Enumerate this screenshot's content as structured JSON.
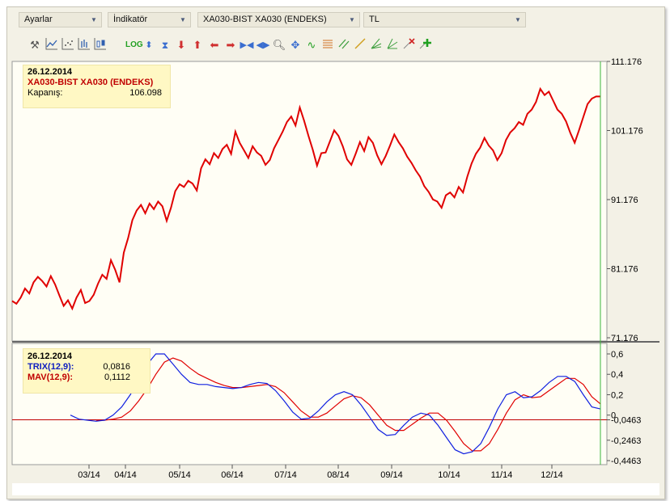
{
  "toolbar": {
    "settings_label": "Ayarlar",
    "indicator_label": "İndikatör",
    "symbol_label": "XA030-BIST XA030 (ENDEKS)",
    "currency_label": "TL",
    "log_label": "LOG"
  },
  "icons": [
    "tools-icon",
    "line-chart-icon",
    "dot-chart-icon",
    "bar-chart-icon",
    "candlestick-icon",
    "log-scale-button",
    "updown-icon",
    "hourglass-icon",
    "arrow-down-icon",
    "arrow-up-icon",
    "arrow-left-icon",
    "arrow-right-icon",
    "shrink-horizontal-icon",
    "expand-horizontal-icon",
    "zoom-icon",
    "move-icon",
    "squiggle-icon",
    "channel-icon",
    "parallel-lines-icon",
    "trendline-icon",
    "fibonacci-icon",
    "fibonacci-fan-icon",
    "delete-drawings-icon",
    "add-icon"
  ],
  "colors": {
    "price_line": "#e00000",
    "trix_line": "#1020e0",
    "mav_line": "#e00000",
    "zero_line": "#c00000",
    "cursor_line": "#3bb53b",
    "panel_bg": "#fffef5"
  },
  "price_info": {
    "date": "26.12.2014",
    "name": "XA030-BIST XA030 (ENDEKS)",
    "close_label": "Kapanış:",
    "close_value": "106.098"
  },
  "indicator_info": {
    "date": "26.12.2014",
    "trix_label": "TRIX(12,9):",
    "trix_value": "0,0816",
    "mav_label": "MAV(12,9):",
    "mav_value": "0,1112"
  },
  "chart_data": [
    {
      "type": "line",
      "ylim": [
        71.176,
        111.176
      ],
      "yticks": [
        "111.176",
        "101.176",
        "91.176",
        "81.176",
        "71.176"
      ],
      "series": [
        {
          "name": "XA030-BIST XA030 (ENDEKS)",
          "values": [
            76.5,
            76.1,
            77.0,
            78.3,
            77.6,
            79.2,
            80.0,
            79.4,
            78.6,
            80.1,
            78.9,
            77.3,
            75.8,
            76.6,
            75.4,
            77.0,
            78.1,
            76.2,
            76.5,
            77.4,
            79.0,
            80.3,
            79.7,
            82.4,
            81.0,
            79.2,
            83.5,
            85.6,
            88.2,
            89.6,
            90.4,
            89.2,
            90.6,
            89.8,
            90.9,
            90.2,
            88.1,
            90.0,
            92.4,
            93.4,
            93.0,
            93.9,
            93.5,
            92.5,
            95.7,
            97.0,
            96.3,
            97.9,
            97.2,
            98.5,
            99.1,
            97.8,
            101.0,
            99.4,
            98.3,
            97.2,
            98.9,
            98.0,
            97.5,
            96.2,
            96.9,
            98.6,
            99.8,
            101.0,
            102.4,
            103.2,
            101.9,
            104.5,
            102.6,
            100.4,
            98.4,
            96.1,
            97.9,
            98.0,
            99.6,
            101.2,
            100.4,
            98.9,
            97.0,
            96.2,
            97.8,
            99.5,
            98.2,
            100.2,
            99.4,
            97.6,
            96.3,
            97.5,
            99.0,
            100.6,
            99.5,
            98.6,
            97.4,
            96.5,
            95.4,
            94.5,
            93.1,
            92.3,
            91.2,
            90.9,
            90.0,
            91.8,
            92.2,
            91.5,
            93.0,
            92.2,
            94.5,
            96.4,
            97.8,
            98.7,
            100.1,
            99.0,
            98.3,
            96.9,
            97.9,
            99.8,
            100.9,
            101.5,
            102.4,
            102.0,
            103.6,
            104.2,
            105.3,
            107.2,
            106.3,
            106.8,
            105.5,
            104.2,
            103.6,
            102.5,
            100.8,
            99.4,
            101.2,
            103.1,
            105.0,
            105.8,
            106.1,
            106.098
          ]
        }
      ]
    },
    {
      "type": "line",
      "ylim": [
        -0.4463,
        0.6
      ],
      "yticks": [
        "0,6",
        "0,4",
        "0,2",
        "0",
        "-0,0463",
        "-0,2463",
        "-0,4463"
      ],
      "x_labels": [
        "03/14",
        "04/14",
        "05/14",
        "06/14",
        "07/14",
        "08/14",
        "09/14",
        "10/14",
        "11/14",
        "12/14"
      ],
      "series": [
        {
          "name": "TRIX(12,9)",
          "values": [
            0.0,
            -0.04,
            -0.05,
            -0.06,
            -0.05,
            0.0,
            0.08,
            0.2,
            0.35,
            0.5,
            0.6,
            0.6,
            0.5,
            0.4,
            0.32,
            0.3,
            0.3,
            0.28,
            0.27,
            0.26,
            0.27,
            0.3,
            0.32,
            0.31,
            0.24,
            0.14,
            0.03,
            -0.04,
            -0.03,
            0.04,
            0.13,
            0.2,
            0.23,
            0.2,
            0.1,
            -0.02,
            -0.14,
            -0.2,
            -0.19,
            -0.1,
            -0.02,
            0.02,
            0.0,
            -0.1,
            -0.22,
            -0.34,
            -0.38,
            -0.36,
            -0.28,
            -0.12,
            0.06,
            0.2,
            0.23,
            0.17,
            0.18,
            0.24,
            0.32,
            0.38,
            0.38,
            0.33,
            0.2,
            0.08,
            0.06
          ]
        },
        {
          "name": "MAV(12,9)",
          "values": [
            null,
            null,
            null,
            -0.05,
            -0.05,
            -0.04,
            -0.02,
            0.04,
            0.14,
            0.26,
            0.4,
            0.52,
            0.56,
            0.53,
            0.46,
            0.4,
            0.36,
            0.32,
            0.29,
            0.27,
            0.27,
            0.28,
            0.29,
            0.3,
            0.28,
            0.22,
            0.13,
            0.04,
            -0.02,
            -0.02,
            0.02,
            0.09,
            0.16,
            0.19,
            0.17,
            0.1,
            0.0,
            -0.1,
            -0.15,
            -0.15,
            -0.09,
            -0.03,
            0.02,
            0.02,
            -0.05,
            -0.16,
            -0.28,
            -0.35,
            -0.35,
            -0.28,
            -0.14,
            0.02,
            0.15,
            0.2,
            0.17,
            0.18,
            0.24,
            0.3,
            0.36,
            0.36,
            0.3,
            0.18,
            0.11
          ]
        }
      ]
    }
  ]
}
